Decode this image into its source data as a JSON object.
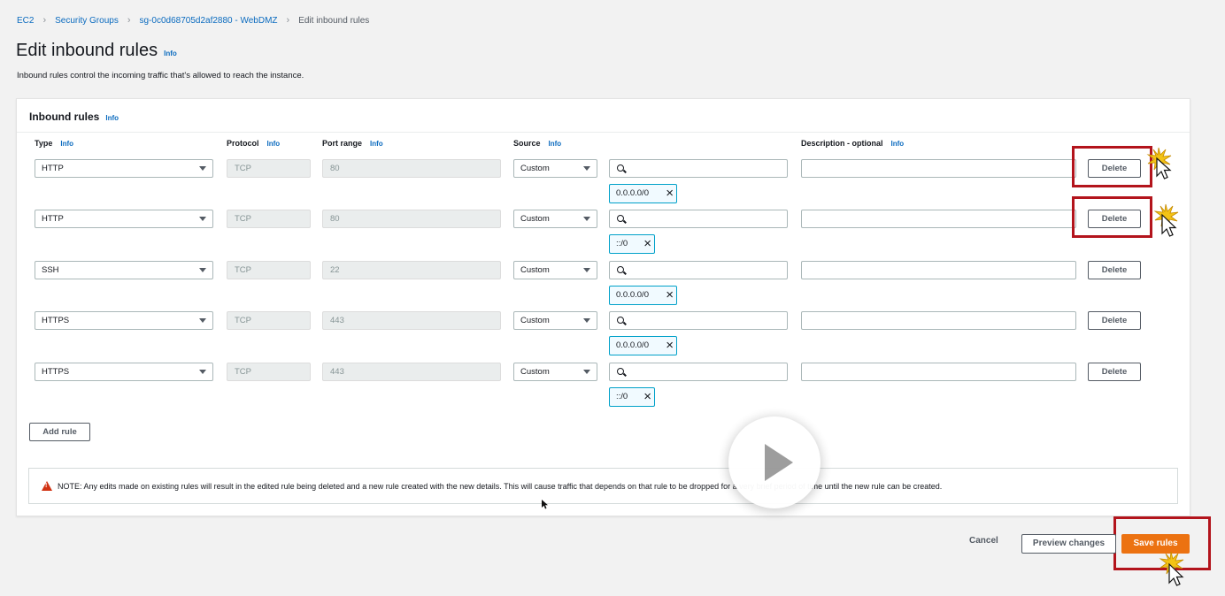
{
  "breadcrumb": {
    "items": [
      "EC2",
      "Security Groups",
      "sg-0c0d68705d2af2880 - WebDMZ"
    ],
    "current": "Edit inbound rules"
  },
  "page": {
    "title": "Edit inbound rules",
    "info": "Info",
    "description": "Inbound rules control the incoming traffic that's allowed to reach the instance."
  },
  "panel": {
    "title": "Inbound rules",
    "info": "Info",
    "columns": {
      "type": "Type",
      "protocol": "Protocol",
      "port_range": "Port range",
      "source": "Source",
      "description": "Description - optional",
      "info": "Info"
    }
  },
  "rules": [
    {
      "type": "HTTP",
      "protocol": "TCP",
      "port": "80",
      "source": "Custom",
      "cidr": "0.0.0.0/0",
      "delete": "Delete"
    },
    {
      "type": "HTTP",
      "protocol": "TCP",
      "port": "80",
      "source": "Custom",
      "cidr": "::/0",
      "delete": "Delete"
    },
    {
      "type": "SSH",
      "protocol": "TCP",
      "port": "22",
      "source": "Custom",
      "cidr": "0.0.0.0/0",
      "delete": "Delete"
    },
    {
      "type": "HTTPS",
      "protocol": "TCP",
      "port": "443",
      "source": "Custom",
      "cidr": "0.0.0.0/0",
      "delete": "Delete"
    },
    {
      "type": "HTTPS",
      "protocol": "TCP",
      "port": "443",
      "source": "Custom",
      "cidr": "::/0",
      "delete": "Delete"
    }
  ],
  "add_rule": "Add rule",
  "note": "NOTE: Any edits made on existing rules will result in the edited rule being deleted and a new rule created with the new details. This will cause traffic that depends on that rule to be dropped for a very brief period of time until the new rule can be created.",
  "footer": {
    "cancel": "Cancel",
    "preview": "Preview changes",
    "save": "Save rules"
  },
  "colors": {
    "accent_orange": "#ec7211",
    "link_blue": "#0b6bbf",
    "highlight_red": "#b3141c",
    "token_border": "#00a1c9"
  },
  "icons": [
    "chevron-right-icon",
    "info-link",
    "caret-down-icon",
    "search-icon",
    "close-icon",
    "warning-icon",
    "play-icon",
    "mouse-cursor-icon"
  ]
}
